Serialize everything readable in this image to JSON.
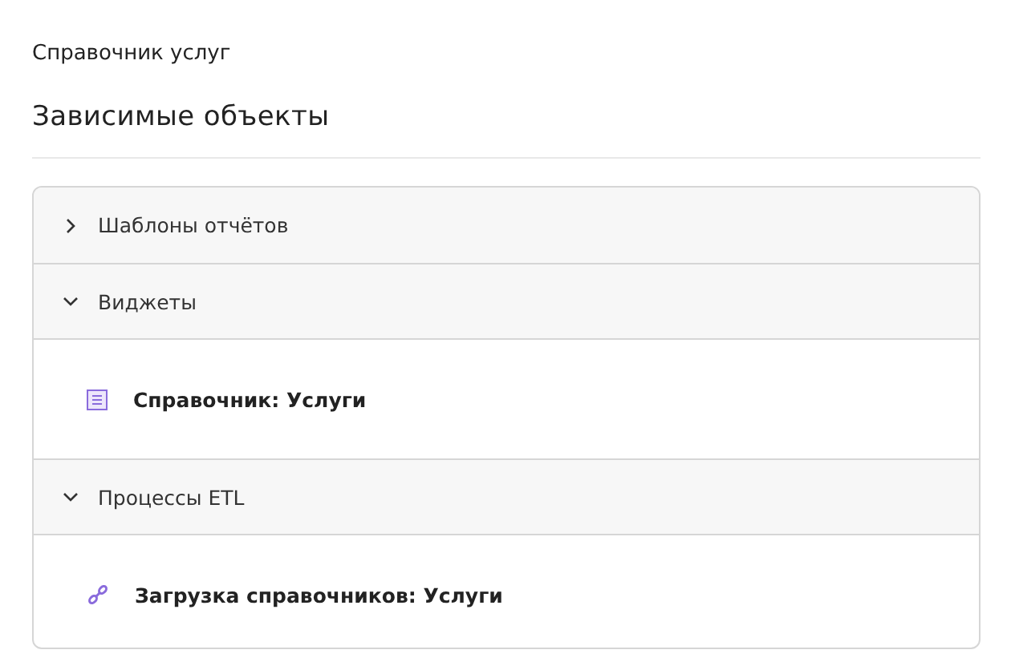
{
  "breadcrumb": "Справочник услуг",
  "title": "Зависимые объекты",
  "sections": [
    {
      "label": "Шаблоны отчётов",
      "expanded": false
    },
    {
      "label": "Виджеты",
      "expanded": true,
      "items": [
        {
          "kind": "widget",
          "label": "Справочник: Услуги"
        }
      ]
    },
    {
      "label": "Процессы ETL",
      "expanded": true,
      "items": [
        {
          "kind": "etl",
          "label": "Загрузка справочников: Услуги"
        }
      ]
    }
  ]
}
